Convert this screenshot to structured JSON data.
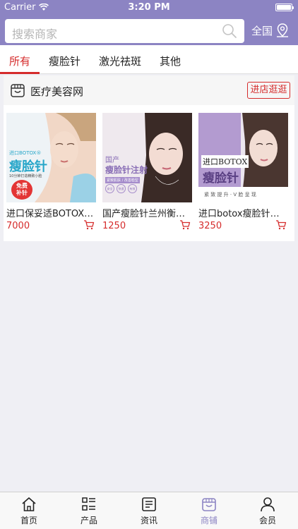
{
  "status_bar": {
    "carrier": "Carrier",
    "time": "3:20 PM"
  },
  "search": {
    "placeholder": "搜索商家",
    "city_label": "全国"
  },
  "tabs": [
    {
      "label": "所有",
      "active": true
    },
    {
      "label": "瘦脸针",
      "active": false
    },
    {
      "label": "激光祛斑",
      "active": false
    },
    {
      "label": "其他",
      "active": false
    }
  ],
  "store": {
    "name": "医疗美容网",
    "enter_label": "进店逛逛",
    "products": [
      {
        "name": "进口保妥适BOTOX瘦脸针",
        "price": "7000",
        "image_text": {
          "brand": "进口BOTOX®",
          "title": "瘦脸针",
          "subtitle": "10分钟打造精致小脸",
          "badge_line1": "免费",
          "badge_line2": "补针"
        }
      },
      {
        "name": "国产瘦脸针兰州衡力瘦脸针",
        "price": "1250",
        "image_text": {
          "line1": "国产",
          "line2": "瘦脸针注射",
          "tag": "紧致肌肤 / 改善脸型",
          "bubble1": "安全",
          "bubble2": "快速",
          "bubble3": "有效"
        }
      },
      {
        "name": "进口botox瘦脸针保妥适",
        "price": "3250",
        "image_text": {
          "line1": "进口BOTOX",
          "line2": "瘦脸针",
          "caption": "紧 致 提 升 · V 脸 呈 现"
        }
      }
    ]
  },
  "tabbar": [
    {
      "label": "首页",
      "icon": "home-icon",
      "active": false
    },
    {
      "label": "产品",
      "icon": "list-icon",
      "active": false
    },
    {
      "label": "资讯",
      "icon": "news-icon",
      "active": false
    },
    {
      "label": "商铺",
      "icon": "store-icon",
      "active": true
    },
    {
      "label": "会员",
      "icon": "user-icon",
      "active": false
    }
  ],
  "colors": {
    "accent": "#8c84c3",
    "highlight": "#d52b2b"
  }
}
